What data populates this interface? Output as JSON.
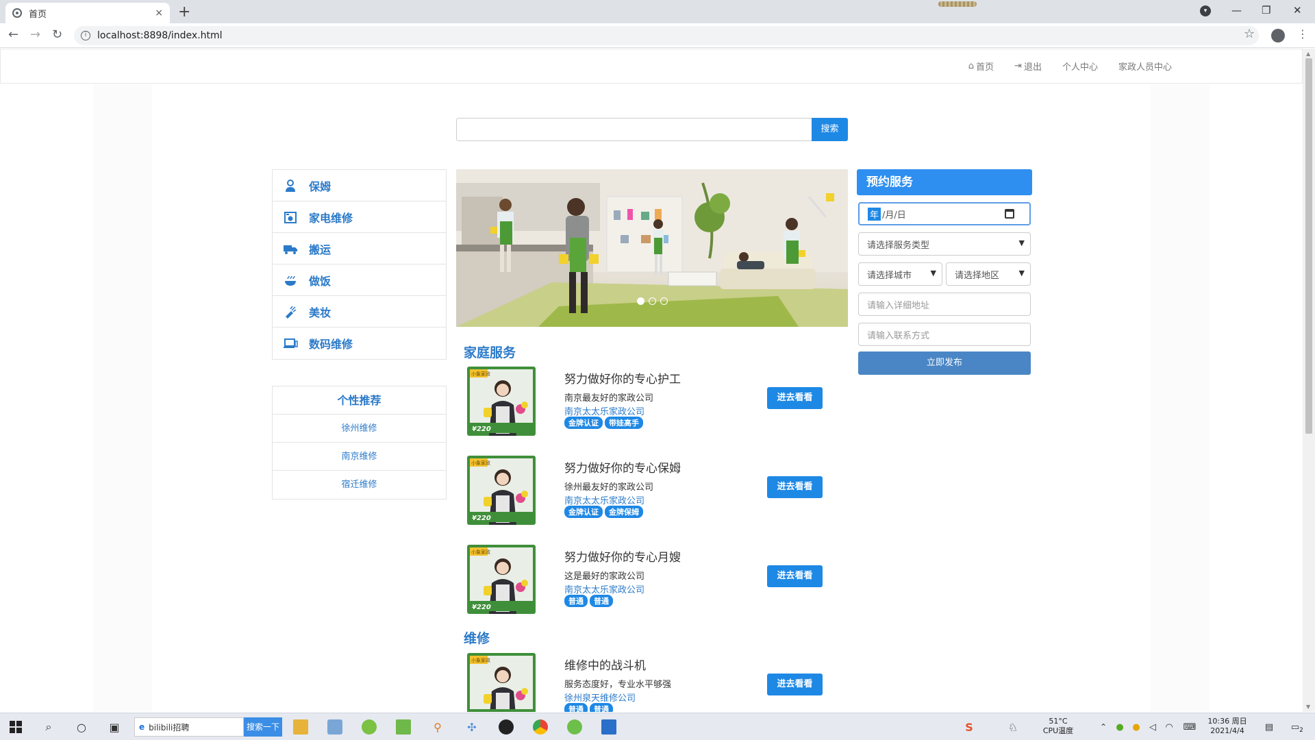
{
  "browser": {
    "tab_title": "首页",
    "tab_close": "×",
    "new_tab": "+",
    "url": "localhost:8898/index.html",
    "info": "i",
    "back": "←",
    "forward": "→",
    "reload": "↻",
    "star": "☆",
    "menu": "⋮",
    "minimize": "—",
    "maximize": "❐",
    "close": "✕"
  },
  "topnav": {
    "home_icon": "⌂",
    "home": "首页",
    "logout_icon": "⇥",
    "logout": "退出",
    "personal": "个人中心",
    "staff": "家政人员中心"
  },
  "search": {
    "button": "搜索",
    "value": ""
  },
  "categories": [
    {
      "label": "保姆",
      "icon": "person-icon"
    },
    {
      "label": "家电维修",
      "icon": "appliance-icon"
    },
    {
      "label": "搬运",
      "icon": "truck-icon"
    },
    {
      "label": "做饭",
      "icon": "cooking-icon"
    },
    {
      "label": "美妆",
      "icon": "makeup-icon"
    },
    {
      "label": "数码维修",
      "icon": "laptop-icon"
    }
  ],
  "recommend": {
    "title": "个性推荐",
    "items": [
      "徐州维修",
      "南京维修",
      "宿迁维修"
    ]
  },
  "sections": {
    "home_service": "家庭服务",
    "repair": "维修"
  },
  "cards": [
    {
      "title": "努力做好你的专心护工",
      "desc": "南京最友好的家政公司",
      "company": "南京太太乐家政公司",
      "tags": [
        "金牌认证",
        "带娃高手"
      ],
      "button": "进去看看"
    },
    {
      "title": "努力做好你的专心保姆",
      "desc": "徐州最友好的家政公司",
      "company": "南京太太乐家政公司",
      "tags": [
        "金牌认证",
        "金牌保姆"
      ],
      "button": "进去看看"
    },
    {
      "title": "努力做好你的专心月嫂",
      "desc": "这是最好的家政公司",
      "company": "南京太太乐家政公司",
      "tags": [
        "普通",
        "普通"
      ],
      "button": "进去看看"
    },
    {
      "title": "维修中的战斗机",
      "desc": "服务态度好，专业水平够强",
      "company": "徐州泉天维修公司",
      "tags": [
        "普通",
        "普通"
      ],
      "button": "进去看看"
    }
  ],
  "thumb_text": {
    "price": "¥220",
    "badge": "小象家政"
  },
  "booking": {
    "title": "预约服务",
    "date_year": "年",
    "date_rest": "/月/日",
    "service_type": "请选择服务类型",
    "city": "请选择城市",
    "area": "请选择地区",
    "address_placeholder": "请输入详细地址",
    "contact_placeholder": "请输入联系方式",
    "publish": "立即发布"
  },
  "taskbar": {
    "search_text": "bilibili招聘",
    "search_button": "搜索一下",
    "temp": "51°C",
    "temp_label": "CPU温度",
    "time": "10:36 周日",
    "date": "2021/4/4",
    "notif_count": "2"
  },
  "colors": {
    "accent": "#1e88e5",
    "link": "#2b7ac9",
    "thumb_green": "#3f8f3a"
  }
}
